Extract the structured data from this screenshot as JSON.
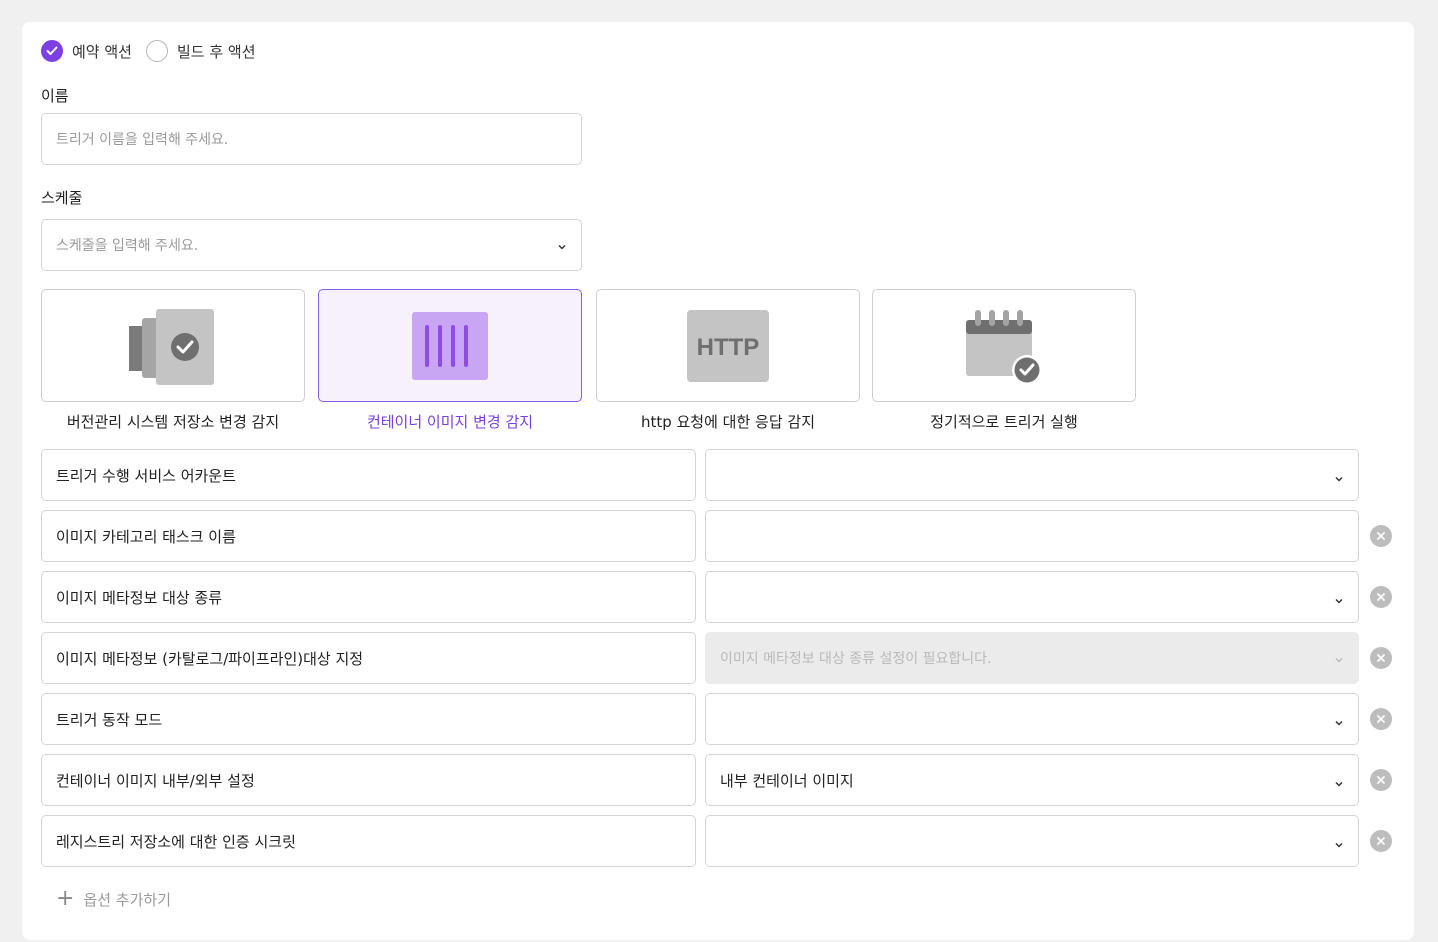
{
  "action_type": {
    "options": [
      {
        "label": "예약 액션",
        "selected": true
      },
      {
        "label": "빌드 후 액션",
        "selected": false
      }
    ]
  },
  "name_field": {
    "label": "이름",
    "placeholder": "트리거 이름을 입력해 주세요."
  },
  "schedule_field": {
    "label": "스케줄",
    "placeholder": "스케줄을 입력해 주세요."
  },
  "trigger_types": [
    {
      "label": "버전관리 시스템 저장소 변경 감지",
      "icon": "repository-check-icon",
      "selected": false
    },
    {
      "label": "컨테이너 이미지 변경 감지",
      "icon": "container-image-icon",
      "selected": true
    },
    {
      "label": "http 요청에 대한 응답 감지",
      "icon": "http-icon",
      "icon_text": "HTTP",
      "selected": false
    },
    {
      "label": "정기적으로 트리거 실행",
      "icon": "calendar-check-icon",
      "selected": false
    }
  ],
  "options": [
    {
      "key": "트리거 수행 서비스 어카운트",
      "value": "",
      "dropdown": true,
      "removable": false,
      "disabled": false
    },
    {
      "key": "이미지 카테고리 태스크 이름",
      "value": "",
      "dropdown": false,
      "removable": true,
      "disabled": false
    },
    {
      "key": "이미지 메타정보 대상 종류",
      "value": "",
      "dropdown": true,
      "removable": true,
      "disabled": false
    },
    {
      "key": "이미지 메타정보 (카탈로그/파이프라인)대상 지정",
      "value": "이미지 메타정보 대상 종류 설정이 필요합니다.",
      "dropdown": true,
      "removable": true,
      "disabled": true
    },
    {
      "key": "트리거 동작 모드",
      "value": "",
      "dropdown": true,
      "removable": true,
      "disabled": false
    },
    {
      "key": "컨테이너 이미지 내부/외부 설정",
      "value": "내부 컨테이너 이미지",
      "dropdown": true,
      "removable": true,
      "disabled": false
    },
    {
      "key": "레지스트리 저장소에 대한 인증 시크릿",
      "value": "",
      "dropdown": true,
      "removable": true,
      "disabled": false
    }
  ],
  "add_option": {
    "label": "옵션 추가하기"
  },
  "colors": {
    "accent": "#7b3fe4",
    "selected_tile_bg": "#f7f1fb",
    "icon_gray": "#c4c4c4",
    "remove_gray": "#bdbdbd"
  }
}
